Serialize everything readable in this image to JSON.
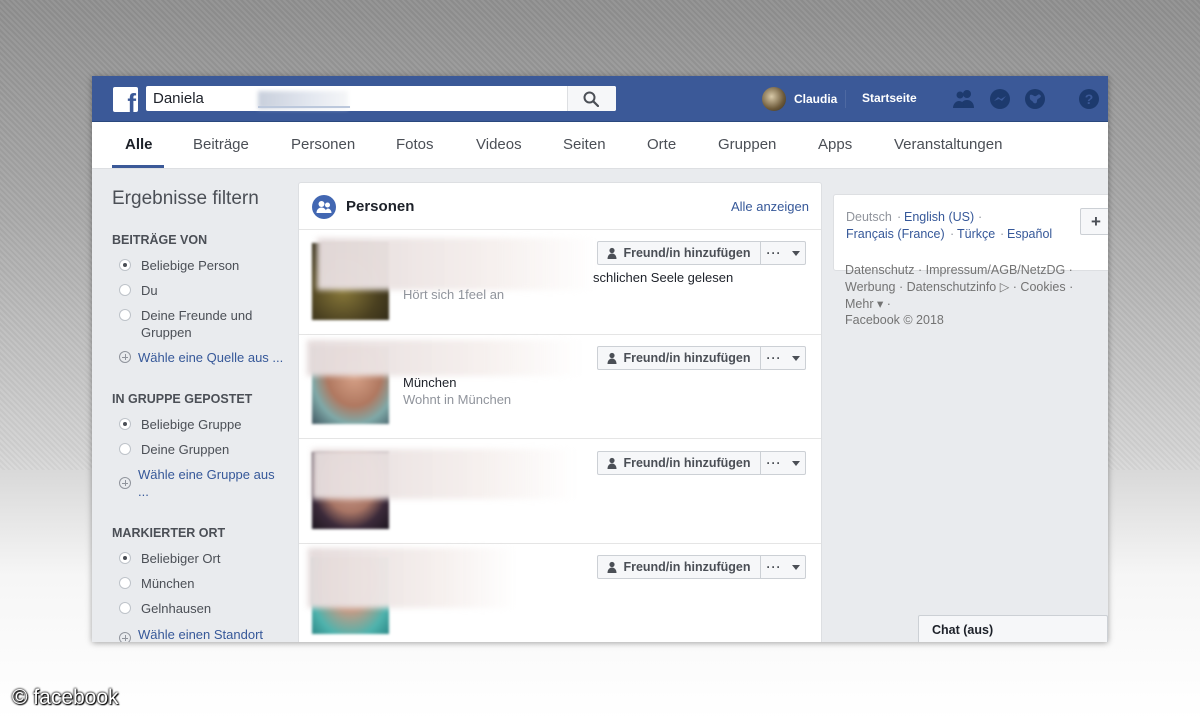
{
  "topbar": {
    "logo_glyph": "f",
    "search_value": "Daniela",
    "user_name": "Claudia",
    "home_label": "Startseite",
    "icons": [
      "friends-icon",
      "messenger-icon",
      "globe-icon",
      "help-icon"
    ]
  },
  "tabs": [
    {
      "label": "Alle",
      "active": true
    },
    {
      "label": "Beiträge"
    },
    {
      "label": "Personen"
    },
    {
      "label": "Fotos"
    },
    {
      "label": "Videos"
    },
    {
      "label": "Seiten"
    },
    {
      "label": "Orte"
    },
    {
      "label": "Gruppen"
    },
    {
      "label": "Apps"
    },
    {
      "label": "Veranstaltungen"
    }
  ],
  "filters": {
    "title": "Ergebnisse filtern",
    "sections": [
      {
        "heading": "BEITRÄGE VON",
        "options": [
          {
            "label": "Beliebige Person",
            "selected": true
          },
          {
            "label": "Du"
          },
          {
            "label": "Deine Freunde und Gruppen"
          }
        ],
        "more": "Wähle eine Quelle aus ..."
      },
      {
        "heading": "IN GRUPPE GEPOSTET",
        "options": [
          {
            "label": "Beliebige Gruppe",
            "selected": true
          },
          {
            "label": "Deine Gruppen"
          }
        ],
        "more": "Wähle eine Gruppe aus ..."
      },
      {
        "heading": "MARKIERTER ORT",
        "options": [
          {
            "label": "Beliebiger Ort",
            "selected": true
          },
          {
            "label": "München"
          },
          {
            "label": "Gelnhausen"
          }
        ],
        "more": "Wähle einen Standort"
      }
    ]
  },
  "people": {
    "title": "Personen",
    "see_all": "Alle anzeigen",
    "add_label": "Freund/in hinzufügen",
    "more_label": "···",
    "results": [
      {
        "line1": "schlichen Seele gelesen",
        "line2": "Hört sich 1feel an"
      },
      {
        "line1": "München",
        "line2": "Wohnt in München"
      },
      {
        "line1": "",
        "line2": ""
      },
      {
        "line1": "",
        "line2": ""
      }
    ]
  },
  "languages": {
    "current": "Deutsch",
    "links": [
      "English (US)",
      "Français (France)",
      "Türkçe",
      "Español"
    ],
    "add_glyph": "+"
  },
  "footer": {
    "line1": "Datenschutz · Impressum/AGB/NetzDG ·",
    "line2": "Werbung · Datenschutzinfo ▷ · Cookies ·",
    "line3": "Mehr ▾ ·",
    "line4": "Facebook © 2018"
  },
  "chat": {
    "label": "Chat (aus)"
  },
  "credit": "© facebook",
  "colors": {
    "brand": "#3b5998",
    "link": "#365899",
    "background": "#e9ebee"
  }
}
